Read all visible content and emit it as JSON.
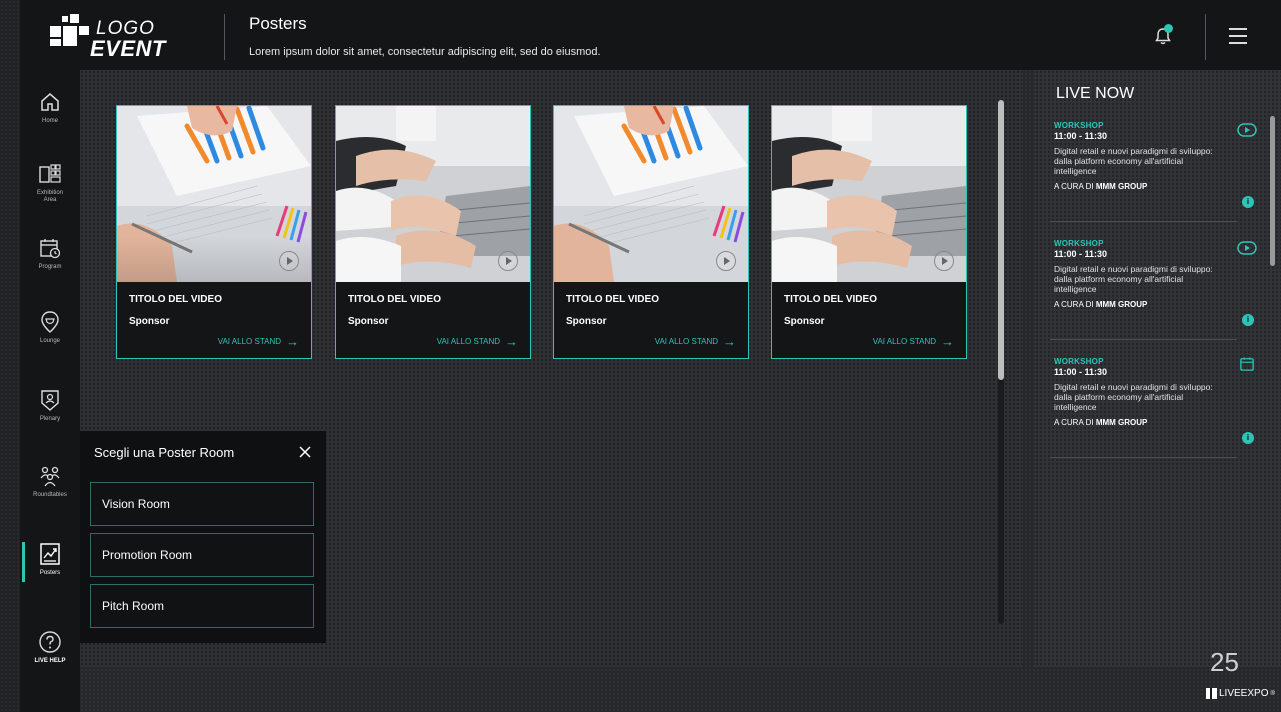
{
  "header": {
    "logo_line1": "LOGO",
    "logo_line2": "EVENT",
    "title": "Posters",
    "subtitle": "Lorem ipsum dolor sit amet, consectetur adipiscing elit, sed do eiusmod."
  },
  "sidebar": {
    "items": [
      {
        "label": "Home",
        "icon": "home-icon"
      },
      {
        "label": "Exhibition Area",
        "icon": "exhibition-icon"
      },
      {
        "label": "Program",
        "icon": "calendar-icon"
      },
      {
        "label": "Lounge",
        "icon": "lounge-icon"
      },
      {
        "label": "Plenary",
        "icon": "plenary-icon"
      },
      {
        "label": "Roundtables",
        "icon": "roundtables-icon"
      },
      {
        "label": "Posters",
        "icon": "posters-icon"
      },
      {
        "label": "LIVE HELP",
        "icon": "help-icon"
      }
    ],
    "active": "Posters"
  },
  "cards": [
    {
      "title": "TITOLO DEL VIDEO",
      "sponsor": "Sponsor",
      "link": "VAI ALLO STAND",
      "image": "chart-papers"
    },
    {
      "title": "TITOLO DEL VIDEO",
      "sponsor": "Sponsor",
      "link": "VAI ALLO STAND",
      "image": "laptop-hands"
    },
    {
      "title": "TITOLO DEL VIDEO",
      "sponsor": "Sponsor",
      "link": "VAI ALLO STAND",
      "image": "chart-papers"
    },
    {
      "title": "TITOLO DEL VIDEO",
      "sponsor": "Sponsor",
      "link": "VAI ALLO STAND",
      "image": "laptop-hands"
    }
  ],
  "room_picker": {
    "title": "Scegli una Poster Room",
    "rooms": [
      "Vision Room",
      "Promotion Room",
      "Pitch Room"
    ]
  },
  "live_now": {
    "title": "LIVE NOW",
    "items": [
      {
        "tag": "WORKSHOP",
        "time": "11:00 - 11:30",
        "desc": "Digital retail e nuovi paradigmi di sviluppo: dalla platform economy all'artificial intelligence",
        "by_prefix": "A CURA DI",
        "by_name": "MMM GROUP",
        "icon": "play-circle-icon"
      },
      {
        "tag": "WORKSHOP",
        "time": "11:00 - 11:30",
        "desc": "Digital retail e nuovi paradigmi di sviluppo: dalla platform economy all'artificial intelligence",
        "by_prefix": "A CURA DI",
        "by_name": "MMM GROUP",
        "icon": "play-circle-icon"
      },
      {
        "tag": "WORKSHOP",
        "time": "11:00 - 11:30",
        "desc": "Digital retail e nuovi paradigmi di sviluppo: dalla platform economy all'artificial intelligence",
        "by_prefix": "A CURA DI",
        "by_name": "MMM GROUP",
        "icon": "calendar-icon"
      }
    ],
    "info_glyph": "i"
  },
  "footer": {
    "page_number": "25",
    "brand": "LIVEEXPO"
  },
  "colors": {
    "accent": "#2ec4b6",
    "header_bg": "#141517"
  }
}
